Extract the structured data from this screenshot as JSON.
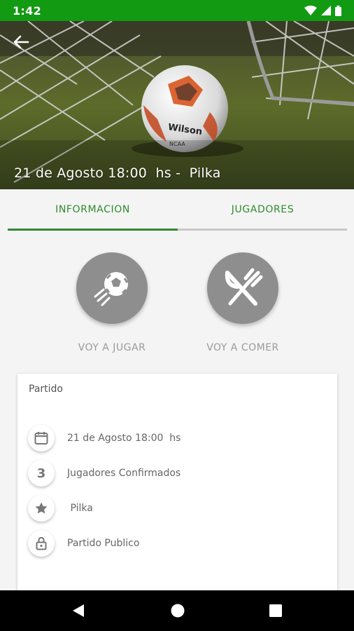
{
  "status_bar": {
    "time": "1:42"
  },
  "header": {
    "title": "21 de Agosto 18:00  hs -  Pilka"
  },
  "tabs": [
    {
      "label": "INFORMACION",
      "active": true
    },
    {
      "label": "JUGADORES",
      "active": false
    }
  ],
  "actions": [
    {
      "label": "VOY A JUGAR",
      "icon": "soccer-ball-icon"
    },
    {
      "label": "VOY A COMER",
      "icon": "fork-knife-icon"
    }
  ],
  "card": {
    "title": "Partido",
    "rows": [
      {
        "icon": "calendar-icon",
        "text": "21 de Agosto 18:00  hs"
      },
      {
        "icon": "number-badge",
        "badge": "3",
        "text": "Jugadores Confirmados"
      },
      {
        "icon": "star-icon",
        "text": " Pilka"
      },
      {
        "icon": "lock-icon",
        "text": "Partido Publico"
      }
    ]
  },
  "colors": {
    "accent": "#2e8b2e",
    "status_bar": "#129a12",
    "action_circle": "#8e8e8e"
  }
}
